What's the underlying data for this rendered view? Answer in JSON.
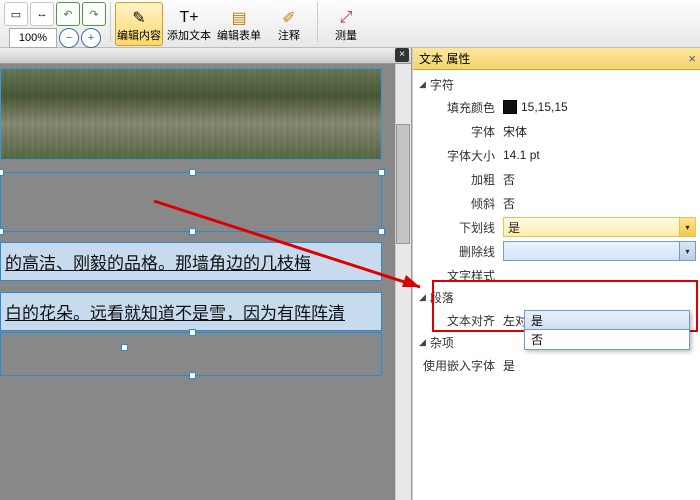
{
  "toolbar": {
    "zoom_value": "100%",
    "edit_content": "编辑内容",
    "add_text": "添加文本",
    "edit_form": "编辑表单",
    "annotate": "注释",
    "measure": "测量"
  },
  "doc": {
    "line1": "的高洁、刚毅的品格。那墙角边的几枝梅",
    "line2": "白的花朵。远看就知道不是雪，因为有阵阵清"
  },
  "panel": {
    "title": "文本 属性",
    "sect_char": "字符",
    "fill_color_lbl": "填充颜色",
    "fill_color_val": "15,15,15",
    "font_lbl": "字体",
    "font_val": "宋体",
    "font_size_lbl": "字体大小",
    "font_size_val": "14.1 pt",
    "bold_lbl": "加粗",
    "bold_val": "否",
    "italic_lbl": "倾斜",
    "italic_val": "否",
    "underline_lbl": "下划线",
    "underline_val": "是",
    "strike_lbl": "删除线",
    "strike_val": "",
    "textstyle_lbl": "文字样式",
    "sect_para": "段落",
    "align_lbl": "文本对齐",
    "align_val": "左对齐",
    "sect_misc": "杂项",
    "embed_lbl": "使用嵌入字体",
    "embed_val": "是",
    "opt_yes": "是",
    "opt_no": "否"
  }
}
